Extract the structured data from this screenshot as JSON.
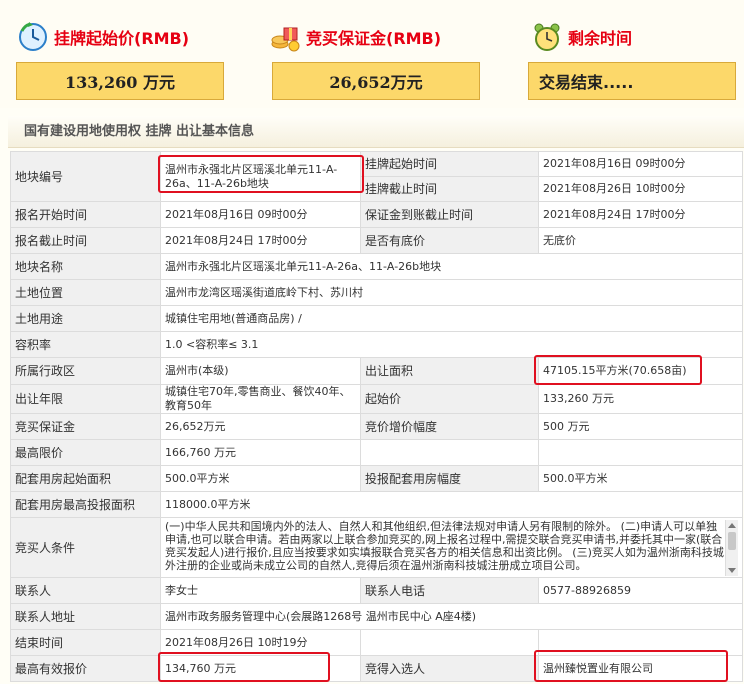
{
  "header": {
    "listing_price_title": "挂牌起始价(RMB)",
    "deposit_title": "竞买保证金(RMB)",
    "remaining_title": "剩余时间",
    "listing_price_value": "133,260 万元",
    "deposit_value": "26,652万元",
    "remaining_value": "交易结束....."
  },
  "section_title": "国有建设用地使用权 挂牌 出让基本信息",
  "fields": {
    "parcel_no_label": "地块编号",
    "parcel_no_value": "温州市永强北片区瑶溪北单元11-A-26a、11-A-26b地块",
    "listing_start_label": "挂牌起始时间",
    "listing_start_value": "2021年08月16日 09时00分",
    "listing_end_label": "挂牌截止时间",
    "listing_end_value": "2021年08月26日 10时00分",
    "reg_start_label": "报名开始时间",
    "reg_start_value": "2021年08月16日 09时00分",
    "deposit_deadline_label": "保证金到账截止时间",
    "deposit_deadline_value": "2021年08月24日 17时00分",
    "reg_end_label": "报名截止时间",
    "reg_end_value": "2021年08月24日 17时00分",
    "reserve_label": "是否有底价",
    "reserve_value": "无底价",
    "name_label": "地块名称",
    "name_value": "温州市永强北片区瑶溪北单元11-A-26a、11-A-26b地块",
    "location_label": "土地位置",
    "location_value": "温州市龙湾区瑶溪街道底岭下村、苏川村",
    "use_label": "土地用途",
    "use_value": "城镇住宅用地(普通商品房) /",
    "far_label": "容积率",
    "far_value": "1.0 <容积率≤ 3.1",
    "district_label": "所属行政区",
    "district_value": "温州市(本级)",
    "area_label": "出让面积",
    "area_value": "47105.15平方米(70.658亩)",
    "term_label": "出让年限",
    "term_value": "城镇住宅70年,零售商业、餐饮40年、教育50年",
    "start_price_label": "起始价",
    "start_price_value": "133,260 万元",
    "bid_deposit_label": "竞买保证金",
    "bid_deposit_value": "26,652万元",
    "increment_label": "竞价增价幅度",
    "increment_value": "500 万元",
    "max_price_label": "最高限价",
    "max_price_value": "166,760 万元",
    "housing_start_label": "配套用房起始面积",
    "housing_start_value": "500.0平方米",
    "housing_inc_label": "投报配套用房幅度",
    "housing_inc_value": "500.0平方米",
    "housing_max_label": "配套用房最高投报面积",
    "housing_max_value": "118000.0平方米",
    "bidder_cond_label": "竞买人条件",
    "bidder_cond_value": "(一)中华人民共和国境内外的法人、自然人和其他组织,但法律法规对申请人另有限制的除外。 (二)申请人可以单独申请,也可以联合申请。若由两家以上联合参加竞买的,网上报名过程中,需提交联合竞买申请书,并委托其中一家(联合竞买发起人)进行报价,且应当按要求如实填报联合竞买各方的相关信息和出资比例。 (三)竞买人如为温州浙南科技城外注册的企业或尚未成立公司的自然人,竞得后须在温州浙南科技城注册成立项目公司。",
    "contact_label": "联系人",
    "contact_value": "李女士",
    "phone_label": "联系人电话",
    "phone_value": "0577-88926859",
    "address_label": "联系人地址",
    "address_value": "温州市政务服务管理中心(会展路1268号 温州市民中心 A座4楼)",
    "end_time_label": "结束时间",
    "end_time_value": "2021年08月26日 10时19分",
    "top_bid_label": "最高有效报价",
    "top_bid_value": "134,760 万元",
    "winner_label": "竞得入选人",
    "winner_value": "温州臻悦置业有限公司"
  },
  "colors": {
    "title_red": "#e60012",
    "value_box_fill": "#fcd86a",
    "label_cell_bg": "#f0f0f0",
    "highlight_box": "#e01020"
  },
  "icons": [
    "clock-refresh-icon",
    "coins-gift-icon",
    "alarm-clock-icon"
  ]
}
